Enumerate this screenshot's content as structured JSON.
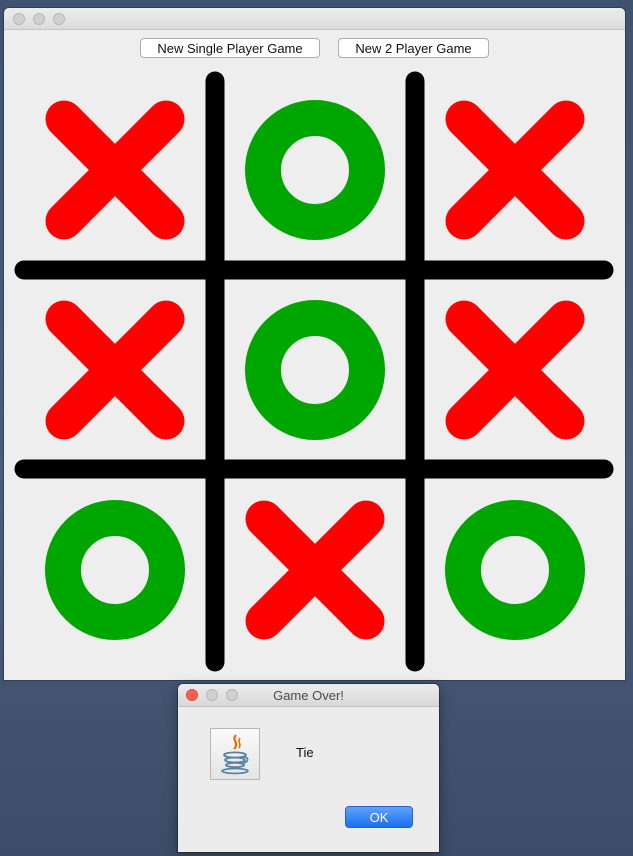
{
  "main_window": {
    "title": "",
    "buttons": {
      "single_player": "New Single Player Game",
      "two_player": "New 2 Player Game"
    }
  },
  "board": {
    "cells": [
      "X",
      "O",
      "X",
      "X",
      "O",
      "X",
      "O",
      "X",
      "O"
    ],
    "colors": {
      "x": "#ff0000",
      "o": "#00a600",
      "grid": "#000000"
    }
  },
  "dialog": {
    "title": "Game Over!",
    "message": "Tie",
    "ok_label": "OK",
    "icon": "java-icon"
  }
}
